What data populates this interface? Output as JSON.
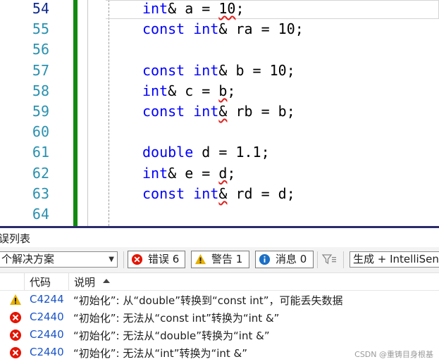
{
  "editor": {
    "line_numbers": [
      "54",
      "55",
      "56",
      "57",
      "58",
      "59",
      "60",
      "61",
      "62",
      "63",
      "64"
    ],
    "lines": [
      {
        "indent": "",
        "tokens": [
          {
            "t": "int",
            "k": "kw"
          },
          {
            "t": "& a = "
          },
          {
            "t": "10",
            "k": "sq"
          },
          {
            "t": ";"
          }
        ]
      },
      {
        "indent": "",
        "tokens": [
          {
            "t": "const",
            "k": "kw"
          },
          {
            "t": " "
          },
          {
            "t": "int",
            "k": "kw"
          },
          {
            "t": "& ra = 10;"
          }
        ]
      },
      {
        "indent": "",
        "tokens": []
      },
      {
        "indent": "",
        "tokens": [
          {
            "t": "const",
            "k": "kw"
          },
          {
            "t": " "
          },
          {
            "t": "int",
            "k": "kw"
          },
          {
            "t": "& b = 10;"
          }
        ]
      },
      {
        "indent": "",
        "tokens": [
          {
            "t": "int",
            "k": "kw"
          },
          {
            "t": "& c = "
          },
          {
            "t": "b",
            "k": "sq"
          },
          {
            "t": ";"
          }
        ]
      },
      {
        "indent": "",
        "tokens": [
          {
            "t": "const",
            "k": "kw"
          },
          {
            "t": " "
          },
          {
            "t": "int",
            "k": "kw"
          },
          {
            "t": "&",
            "k": "sq"
          },
          {
            "t": " rb = b;"
          }
        ]
      },
      {
        "indent": "",
        "tokens": []
      },
      {
        "indent": "",
        "tokens": [
          {
            "t": "double",
            "k": "kw"
          },
          {
            "t": " d = 1.1;"
          }
        ]
      },
      {
        "indent": "",
        "tokens": [
          {
            "t": "int",
            "k": "kw"
          },
          {
            "t": "& e = "
          },
          {
            "t": "d",
            "k": "sq"
          },
          {
            "t": ";"
          }
        ]
      },
      {
        "indent": "",
        "tokens": [
          {
            "t": "const",
            "k": "kw"
          },
          {
            "t": " "
          },
          {
            "t": "int",
            "k": "kw"
          },
          {
            "t": "&",
            "k": "sq"
          },
          {
            "t": " rd = d;"
          }
        ]
      },
      {
        "indent": "",
        "tokens": []
      }
    ]
  },
  "panel": {
    "title": "误列表",
    "scope_label": "个解决方案",
    "errors_label": "错误 6",
    "warnings_label": "警告 1",
    "messages_label": "消息 0",
    "build_label": "生成 + IntelliSense",
    "columns": {
      "code": "代码",
      "description": "说明"
    },
    "rows": [
      {
        "severity": "warning",
        "code": "C4244",
        "description": "“初始化”: 从“double”转换到“const int”，可能丢失数据"
      },
      {
        "severity": "error",
        "code": "C2440",
        "description": "“初始化”: 无法从“const int”转换为“int &”"
      },
      {
        "severity": "error",
        "code": "C2440",
        "description": "“初始化”: 无法从“double”转换为“int &”"
      },
      {
        "severity": "error",
        "code": "C2440",
        "description": "“初始化”: 无法从“int”转换为“int &”"
      }
    ]
  },
  "watermark": "CSDN @重铸目身根基",
  "colors": {
    "keyword": "#0000ff",
    "line_number": "#2b91af",
    "change_bar": "#108a10",
    "error_red": "#e51400",
    "warning_yellow": "#e8b000",
    "info_blue": "#1ba1e2",
    "code_link": "#1a55c8"
  },
  "icons": {
    "error": "error-circle-icon",
    "warning": "warning-triangle-icon",
    "message": "info-circle-icon",
    "filter": "filter-icon",
    "dropdown": "chevron-down-icon",
    "sort": "sort-ascending-icon"
  }
}
